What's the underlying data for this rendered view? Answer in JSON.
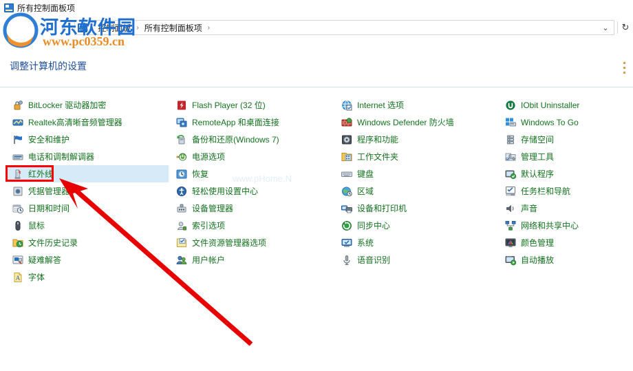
{
  "window": {
    "title": "所有控制面板项",
    "title_icon": "control-panel-icon"
  },
  "addressbar": {
    "back_icon": "back-arrow-icon",
    "forward_icon": "forward-arrow-icon",
    "recent_icon": "chevron-down-icon",
    "up_icon": "up-arrow-icon",
    "path_icon": "control-panel-icon",
    "breadcrumbs": [
      {
        "label": "控制面板"
      },
      {
        "label": "所有控制面板项"
      }
    ],
    "separator": "›",
    "dropdown_icon": "chevron-down-icon",
    "refresh_icon": "refresh-icon"
  },
  "header": {
    "title": "调整计算机的设置"
  },
  "colors": {
    "link": "#14711f",
    "header": "#1f4e9c",
    "selection": "#d6eaf8",
    "highlight_box": "#ff0000",
    "arrow": "#e60000",
    "watermark_brand": "#1f6fd0",
    "watermark_url": "#e98b24"
  },
  "selection": {
    "selected_item": "红外线"
  },
  "columns": [
    {
      "name": "column-1",
      "items": [
        {
          "label": "BitLocker 驱动器加密",
          "icon": "bitlocker-icon"
        },
        {
          "label": "Realtek高清晰音频管理器",
          "icon": "realtek-audio-icon"
        },
        {
          "label": "安全和维护",
          "icon": "flag-icon"
        },
        {
          "label": "电话和调制解调器",
          "icon": "modem-icon"
        },
        {
          "label": "红外线",
          "icon": "infrared-icon",
          "selected": true
        },
        {
          "label": "凭据管理器",
          "icon": "credential-manager-icon"
        },
        {
          "label": "日期和时间",
          "icon": "date-time-icon"
        },
        {
          "label": "鼠标",
          "icon": "mouse-icon"
        },
        {
          "label": "文件历史记录",
          "icon": "file-history-icon"
        },
        {
          "label": "疑难解答",
          "icon": "troubleshoot-icon"
        },
        {
          "label": "字体",
          "icon": "fonts-icon"
        }
      ]
    },
    {
      "name": "column-2",
      "items": [
        {
          "label": "Flash Player (32 位)",
          "icon": "flash-player-icon"
        },
        {
          "label": "RemoteApp 和桌面连接",
          "icon": "remoteapp-icon"
        },
        {
          "label": "备份和还原(Windows 7)",
          "icon": "backup-restore-icon"
        },
        {
          "label": "电源选项",
          "icon": "power-options-icon"
        },
        {
          "label": "恢复",
          "icon": "recovery-icon"
        },
        {
          "label": "轻松使用设置中心",
          "icon": "ease-of-access-icon"
        },
        {
          "label": "设备管理器",
          "icon": "device-manager-icon"
        },
        {
          "label": "索引选项",
          "icon": "indexing-options-icon"
        },
        {
          "label": "文件资源管理器选项",
          "icon": "file-explorer-options-icon"
        },
        {
          "label": "用户帐户",
          "icon": "user-accounts-icon"
        }
      ]
    },
    {
      "name": "column-3",
      "items": [
        {
          "label": "Internet 选项",
          "icon": "internet-options-icon"
        },
        {
          "label": "Windows Defender 防火墙",
          "icon": "firewall-icon"
        },
        {
          "label": "程序和功能",
          "icon": "programs-features-icon"
        },
        {
          "label": "工作文件夹",
          "icon": "work-folders-icon"
        },
        {
          "label": "键盘",
          "icon": "keyboard-icon"
        },
        {
          "label": "区域",
          "icon": "region-icon"
        },
        {
          "label": "设备和打印机",
          "icon": "devices-printers-icon"
        },
        {
          "label": "同步中心",
          "icon": "sync-center-icon"
        },
        {
          "label": "系统",
          "icon": "system-icon"
        },
        {
          "label": "语音识别",
          "icon": "speech-recognition-icon"
        }
      ]
    },
    {
      "name": "column-4",
      "items": [
        {
          "label": "IObit Uninstaller",
          "icon": "iobit-uninstaller-icon"
        },
        {
          "label": "Windows To Go",
          "icon": "windows-to-go-icon"
        },
        {
          "label": "存储空间",
          "icon": "storage-spaces-icon"
        },
        {
          "label": "管理工具",
          "icon": "administrative-tools-icon"
        },
        {
          "label": "默认程序",
          "icon": "default-programs-icon"
        },
        {
          "label": "任务栏和导航",
          "icon": "taskbar-navigation-icon"
        },
        {
          "label": "声音",
          "icon": "sound-icon"
        },
        {
          "label": "网络和共享中心",
          "icon": "network-sharing-icon"
        },
        {
          "label": "颜色管理",
          "icon": "color-management-icon"
        },
        {
          "label": "自动播放",
          "icon": "autoplay-icon"
        }
      ]
    }
  ],
  "watermarks": {
    "brand": "河东软件园",
    "url": "www.pc0359.cn",
    "faint": "www.pHome.N"
  }
}
